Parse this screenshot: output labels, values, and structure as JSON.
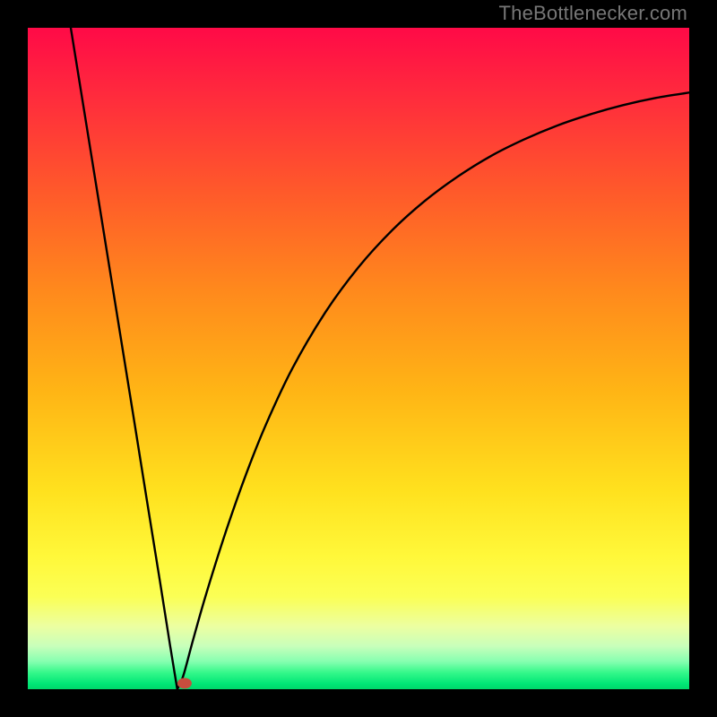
{
  "watermark": "TheBottlenecker.com",
  "colors": {
    "frame": "#000000",
    "curve": "#000000",
    "marker": "#c84d3e",
    "gradient_stops": [
      {
        "offset": 0.0,
        "color": "#ff0a47"
      },
      {
        "offset": 0.1,
        "color": "#ff2a3d"
      },
      {
        "offset": 0.25,
        "color": "#ff5a2a"
      },
      {
        "offset": 0.4,
        "color": "#ff8a1c"
      },
      {
        "offset": 0.55,
        "color": "#ffb515"
      },
      {
        "offset": 0.7,
        "color": "#ffe11e"
      },
      {
        "offset": 0.8,
        "color": "#fff83a"
      },
      {
        "offset": 0.86,
        "color": "#fbff55"
      },
      {
        "offset": 0.905,
        "color": "#ecffa1"
      },
      {
        "offset": 0.935,
        "color": "#c8ffbb"
      },
      {
        "offset": 0.958,
        "color": "#86ffb0"
      },
      {
        "offset": 0.975,
        "color": "#34f88a"
      },
      {
        "offset": 0.992,
        "color": "#00e676"
      },
      {
        "offset": 1.0,
        "color": "#00d66a"
      }
    ]
  },
  "chart_data": {
    "type": "line",
    "title": "",
    "xlabel": "",
    "ylabel": "",
    "xlim": [
      0,
      100
    ],
    "ylim": [
      0,
      100
    ],
    "notch_x": 22.6,
    "marker": {
      "x": 23.7,
      "y": 0.9
    },
    "series": [
      {
        "name": "bottleneck-curve",
        "x": [
          6.5,
          8,
          10,
          12,
          14,
          16,
          18,
          20,
          21.5,
          22.6,
          23.5,
          25,
          27,
          30,
          33,
          36,
          40,
          45,
          50,
          55,
          60,
          65,
          70,
          75,
          80,
          85,
          90,
          95,
          100
        ],
        "y": [
          100,
          90.7,
          78.3,
          65.9,
          53.5,
          41.1,
          28.6,
          16.2,
          6.7,
          0,
          2.0,
          7.5,
          14.5,
          24.0,
          32.5,
          40.0,
          48.5,
          57.0,
          63.8,
          69.3,
          73.8,
          77.5,
          80.6,
          83.1,
          85.2,
          86.9,
          88.3,
          89.4,
          90.2
        ]
      }
    ]
  }
}
